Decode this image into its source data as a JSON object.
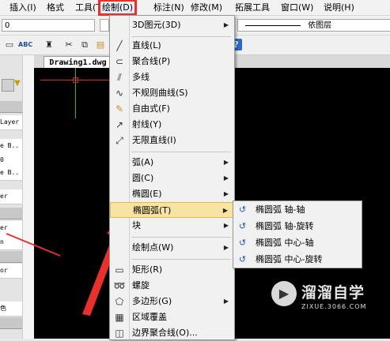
{
  "menubar": {
    "items": [
      {
        "label": "插入(I)"
      },
      {
        "label": "格式"
      },
      {
        "label": "工具(T)"
      },
      {
        "label": "绘制(D)"
      },
      {
        "label": "标注(N)"
      },
      {
        "label": "修改(M)"
      },
      {
        "label": "拓展工具"
      },
      {
        "label": "窗口(W)"
      },
      {
        "label": "说明(H)"
      }
    ]
  },
  "toolbar": {
    "layer_value": "0",
    "linetype_value": "依图层"
  },
  "tabs": {
    "drawing_tab": "Drawing1.dwg"
  },
  "palette": {
    "rows": [
      "Layer",
      "e B..",
      "0",
      "e B..",
      "er",
      "er",
      "n",
      "or",
      "色"
    ]
  },
  "draw_menu": {
    "items": [
      {
        "label": "3D图元(3D)",
        "icon": "3d-icon",
        "submenu": true
      },
      {
        "label": "直线(L)",
        "icon": "line-icon"
      },
      {
        "label": "聚合线(P)",
        "icon": "polyline-icon"
      },
      {
        "label": "多线",
        "icon": "multiline-icon"
      },
      {
        "label": "不规则曲线(S)",
        "icon": "spline-icon"
      },
      {
        "label": "自由式(F)",
        "icon": "freehand-icon"
      },
      {
        "label": "射线(Y)",
        "icon": "ray-icon"
      },
      {
        "label": "无限直线(I)",
        "icon": "xline-icon"
      },
      {
        "label": "弧(A)",
        "icon": "",
        "submenu": true
      },
      {
        "label": "圆(C)",
        "icon": "",
        "submenu": true
      },
      {
        "label": "椭圆(E)",
        "icon": "",
        "submenu": true
      },
      {
        "label": "椭圆弧(T)",
        "icon": "",
        "submenu": true
      },
      {
        "label": "块",
        "icon": "",
        "submenu": true
      },
      {
        "label": "绘制点(W)",
        "icon": "",
        "submenu": true
      },
      {
        "label": "矩形(R)",
        "icon": "rectangle-icon"
      },
      {
        "label": "螺旋",
        "icon": "helix-icon"
      },
      {
        "label": "多边形(G)",
        "icon": "polygon-icon",
        "submenu": true
      },
      {
        "label": "区域覆盖",
        "icon": "wipeout-icon"
      },
      {
        "label": "边界聚合线(O)...",
        "icon": "boundary-icon"
      }
    ]
  },
  "ellipse_arc_submenu": {
    "items": [
      {
        "label": "椭圆弧 轴-轴"
      },
      {
        "label": "椭圆弧 轴-旋转"
      },
      {
        "label": "椭圆弧 中心-轴"
      },
      {
        "label": "椭圆弧 中心-旋转"
      }
    ]
  },
  "watermark": {
    "title": "溜溜自学",
    "url": "ZIXUE.3066.COM"
  },
  "colors": {
    "highlight": "#e8312a",
    "menu_active": "#f7e3a2",
    "canvas": "#000000"
  }
}
